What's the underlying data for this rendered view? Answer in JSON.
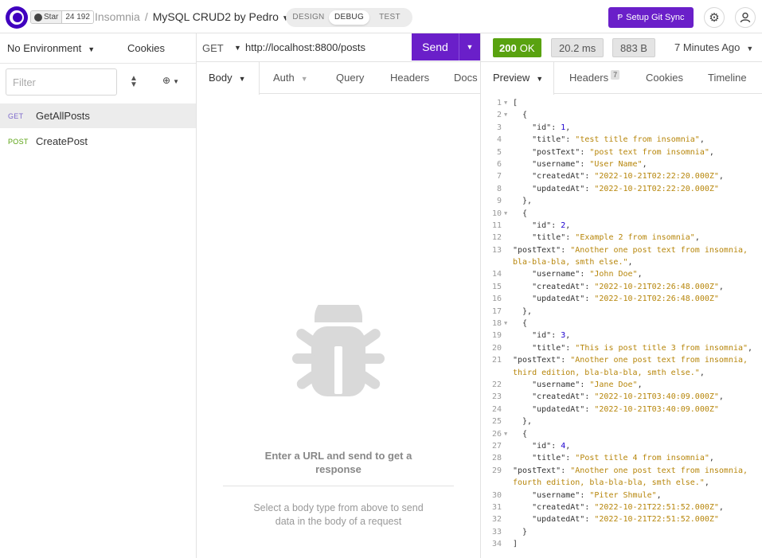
{
  "topbar": {
    "github": {
      "star_label": "Star",
      "star_count": "24 192"
    },
    "breadcrumb": {
      "app": "Insomnia",
      "separator": "/",
      "project": "MySQL CRUD2 by Pedro"
    },
    "modes": [
      "DESIGN",
      "DEBUG",
      "TEST"
    ],
    "active_mode": "DEBUG",
    "git_sync_label": "Setup Git Sync",
    "settings_icon": "gear-icon",
    "account_icon": "user-icon"
  },
  "sidebar": {
    "environment": "No Environment",
    "cookies_label": "Cookies",
    "filter_placeholder": "Filter",
    "requests": [
      {
        "method": "GET",
        "name": "GetAllPosts",
        "active": true
      },
      {
        "method": "POST",
        "name": "CreatePost",
        "active": false
      }
    ]
  },
  "request": {
    "method": "GET",
    "url": "http://localhost:8800/posts",
    "send_label": "Send",
    "tabs": [
      "Body",
      "Auth",
      "Query",
      "Headers",
      "Docs"
    ],
    "empty_title": "Enter a URL and send to get a response",
    "empty_hint": "Select a body type from above to send data in the body of a request"
  },
  "response": {
    "status_code": "200",
    "status_text": "OK",
    "time": "20.2 ms",
    "size": "883 B",
    "ago": "7 Minutes Ago",
    "tabs": [
      "Preview",
      "Headers",
      "Cookies",
      "Timeline"
    ],
    "headers_count": "7",
    "accent_green": "#59a210",
    "accent_purple": "#6a1fc9",
    "body_lines": [
      "[",
      "  {",
      "    \"id\": 1,",
      "    \"title\": \"test title from insomnia\",",
      "    \"postText\": \"post text from insomnia\",",
      "    \"username\": \"User Name\",",
      "    \"createdAt\": \"2022-10-21T02:22:20.000Z\",",
      "    \"updatedAt\": \"2022-10-21T02:22:20.000Z\"",
      "  },",
      "  {",
      "    \"id\": 2,",
      "    \"title\": \"Example 2 from insomnia\",",
      "    \"postText\": \"Another one post text from insomnia, bla-bla-bla, smth else.\",",
      "    \"username\": \"John Doe\",",
      "    \"createdAt\": \"2022-10-21T02:26:48.000Z\",",
      "    \"updatedAt\": \"2022-10-21T02:26:48.000Z\"",
      "  },",
      "  {",
      "    \"id\": 3,",
      "    \"title\": \"This is post title 3 from insomnia\",",
      "    \"postText\": \"Another one post text from insomnia, third edition, bla-bla-bla, smth else.\",",
      "    \"username\": \"Jane Doe\",",
      "    \"createdAt\": \"2022-10-21T03:40:09.000Z\",",
      "    \"updatedAt\": \"2022-10-21T03:40:09.000Z\"",
      "  },",
      "  {",
      "    \"id\": 4,",
      "    \"title\": \"Post title 4 from insomnia\",",
      "    \"postText\": \"Another one post text from insomnia, fourth edition, bla-bla-bla, smth else.\",",
      "    \"username\": \"Piter Shmule\",",
      "    \"createdAt\": \"2022-10-21T22:51:52.000Z\",",
      "    \"updatedAt\": \"2022-10-21T22:51:52.000Z\"",
      "  }",
      "]"
    ]
  }
}
